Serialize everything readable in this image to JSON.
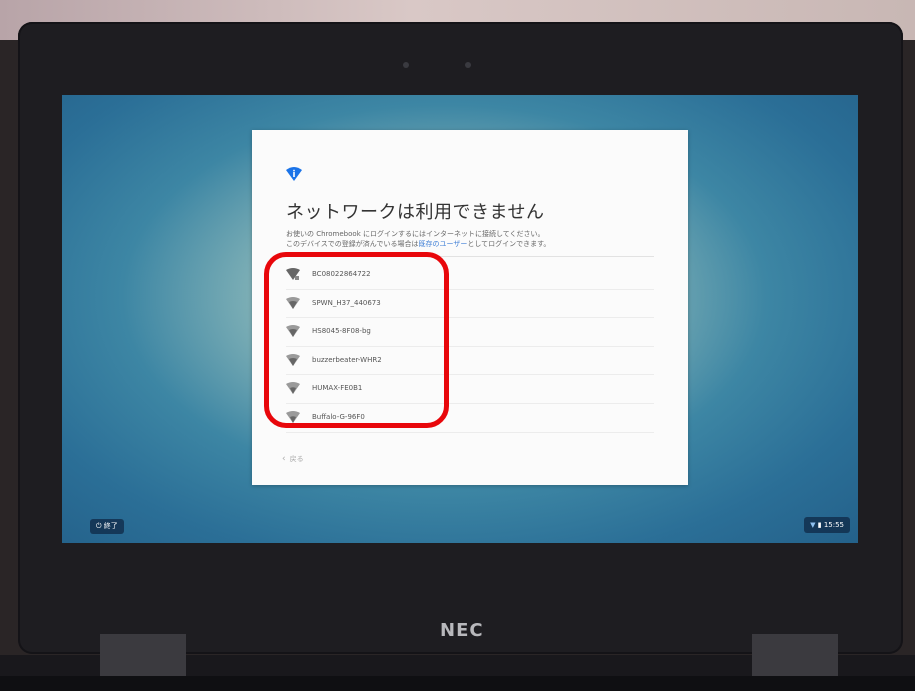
{
  "dialog": {
    "title": "ネットワークは利用できません",
    "description_line1": "お使いの Chromebook にログインするにはインターネットに接続してください。",
    "description_line2_prefix": "このデバイスでの登録が済んでいる場合は",
    "description_line2_link": "既存のユーザー",
    "description_line2_suffix": "としてログインできます。",
    "back_label": "戻る"
  },
  "networks": [
    {
      "name": "BC08022864722"
    },
    {
      "name": "SPWN_H37_440673"
    },
    {
      "name": "HS8045-8F08-bg"
    },
    {
      "name": "buzzerbeater-WHR2"
    },
    {
      "name": "HUMAX-FE0B1"
    },
    {
      "name": "Buffalo-G-96F0"
    }
  ],
  "shelf": {
    "shutdown_label": "終了",
    "clock": "15:55"
  },
  "device": {
    "brand": "NEC"
  },
  "colors": {
    "highlight": "#e8070b",
    "accent": "#1a73e8",
    "link": "#3f7fd6"
  },
  "icons": [
    "info-icon",
    "wifi-icon",
    "chevron-left-icon",
    "power-icon",
    "battery-icon"
  ]
}
